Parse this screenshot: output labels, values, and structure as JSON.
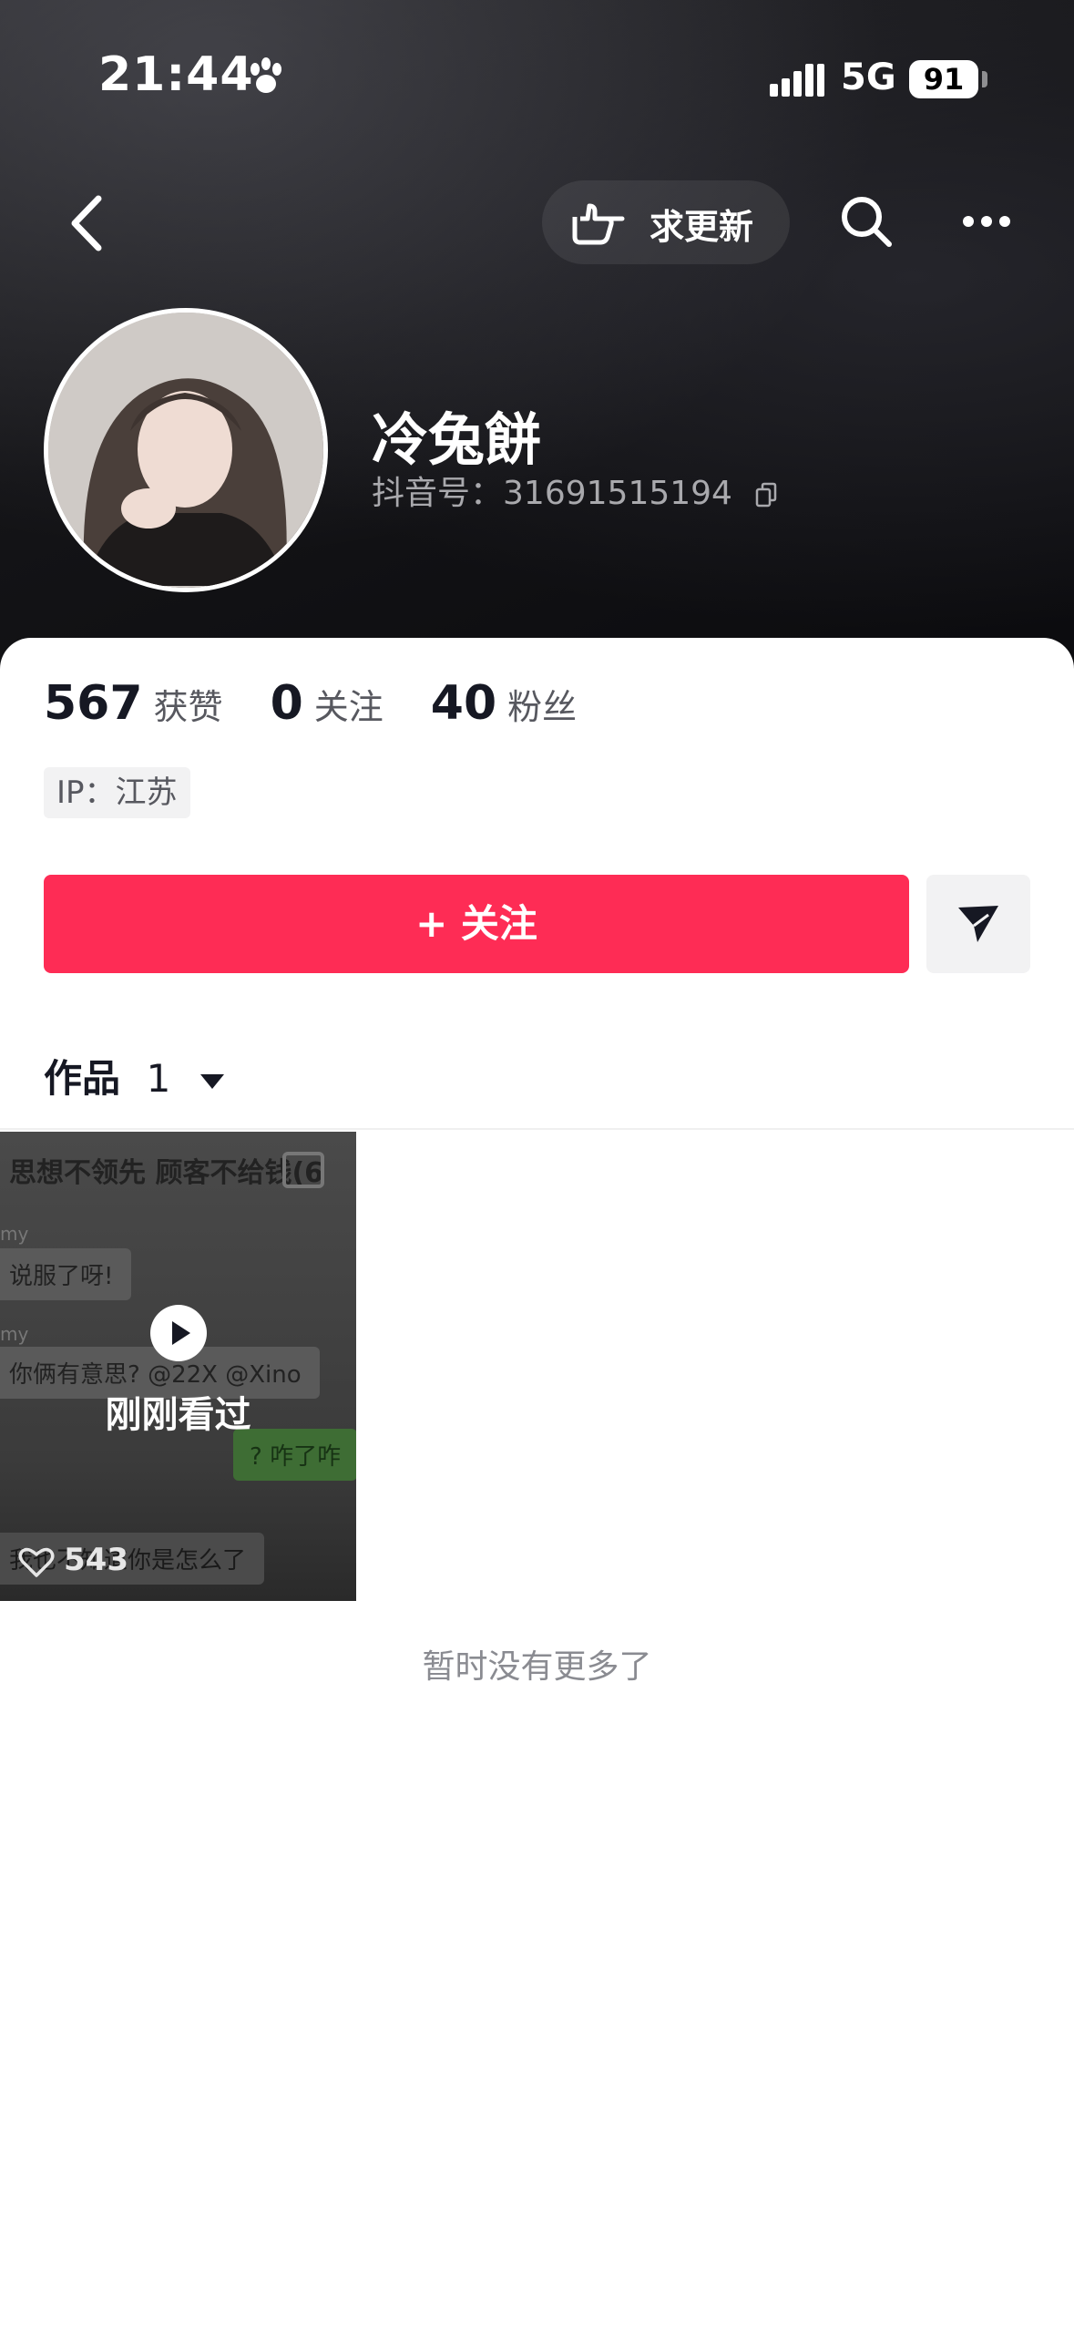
{
  "status_bar": {
    "time": "21:44",
    "network": "5G",
    "battery": "91"
  },
  "nav": {
    "request_update_label": "求更新"
  },
  "profile": {
    "nickname": "冷兔餅",
    "account_label": "抖音号：",
    "account_id": "31691515194"
  },
  "stats": [
    {
      "value": "567",
      "label": "获赞"
    },
    {
      "value": "0",
      "label": "关注"
    },
    {
      "value": "40",
      "label": "粉丝"
    }
  ],
  "ip_tag": "IP：江苏",
  "follow_button": "+ 关注",
  "works_tab": {
    "label": "作品",
    "count": "1"
  },
  "video": {
    "caption_line": "思想不领先 顾客不给钱(6",
    "chat_user": "my",
    "bubble1": "说服了呀!",
    "bubble2": "你俩有意思? @22X @Xino",
    "bubble3": "? 咋了咋",
    "bubble4": "我也不知道你是怎么了",
    "watched_label": "刚刚看过",
    "likes": "543"
  },
  "footer_note": "暂时没有更多了",
  "colors": {
    "accent": "#fe2c55",
    "text_primary": "#161823",
    "text_secondary": "#57585f"
  },
  "icons": [
    "paw-icon",
    "signal-icon",
    "back-icon",
    "pointing-hand-icon",
    "search-icon",
    "more-icon",
    "copy-icon",
    "send-icon",
    "play-icon",
    "heart-icon"
  ]
}
